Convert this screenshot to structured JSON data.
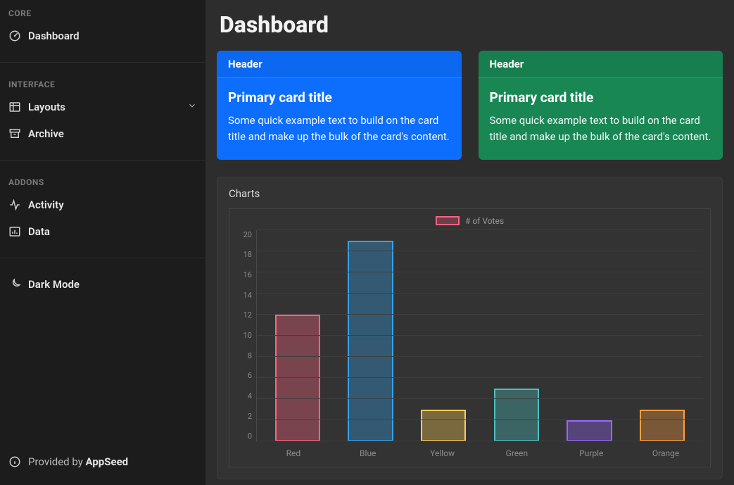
{
  "sidebar": {
    "sections": {
      "core": {
        "label": "CORE",
        "items": [
          {
            "label": "Dashboard",
            "icon": "gauge"
          }
        ]
      },
      "interface": {
        "label": "INTERFACE",
        "items": [
          {
            "label": "Layouts",
            "icon": "columns",
            "expandable": true
          },
          {
            "label": "Archive",
            "icon": "archive"
          }
        ]
      },
      "addons": {
        "label": "ADDONS",
        "items": [
          {
            "label": "Activity",
            "icon": "activity"
          },
          {
            "label": "Data",
            "icon": "bar-chart"
          }
        ]
      }
    },
    "dark_mode_label": "Dark Mode",
    "footer_prefix": "Provided by ",
    "footer_brand": "AppSeed"
  },
  "page": {
    "title": "Dashboard"
  },
  "cards": {
    "primary": {
      "header": "Header",
      "title": "Primary card title",
      "text": "Some quick example text to build on the card title and make up the bulk of the card's content."
    },
    "success": {
      "header": "Header",
      "title": "Primary card title",
      "text": "Some quick example text to build on the card title and make up the bulk of the card's content."
    }
  },
  "chart_panel": {
    "title": "Charts"
  },
  "chart_data": {
    "type": "bar",
    "legend": "# of Votes",
    "categories": [
      "Red",
      "Blue",
      "Yellow",
      "Green",
      "Purple",
      "Orange"
    ],
    "values": [
      12,
      19,
      3,
      5,
      2,
      3
    ],
    "y_ticks": [
      20,
      18,
      16,
      14,
      12,
      10,
      8,
      6,
      4,
      2,
      0
    ],
    "ymax": 20,
    "colors": {
      "fill": [
        "rgba(255,99,132,0.35)",
        "rgba(54,162,235,0.35)",
        "rgba(255,206,86,0.35)",
        "rgba(75,192,192,0.35)",
        "rgba(153,102,255,0.35)",
        "rgba(255,159,64,0.35)"
      ],
      "border": [
        "rgba(255,99,132,1)",
        "rgba(54,162,235,1)",
        "rgba(255,206,86,1)",
        "rgba(75,192,192,1)",
        "rgba(153,102,255,1)",
        "rgba(255,159,64,1)"
      ]
    }
  }
}
